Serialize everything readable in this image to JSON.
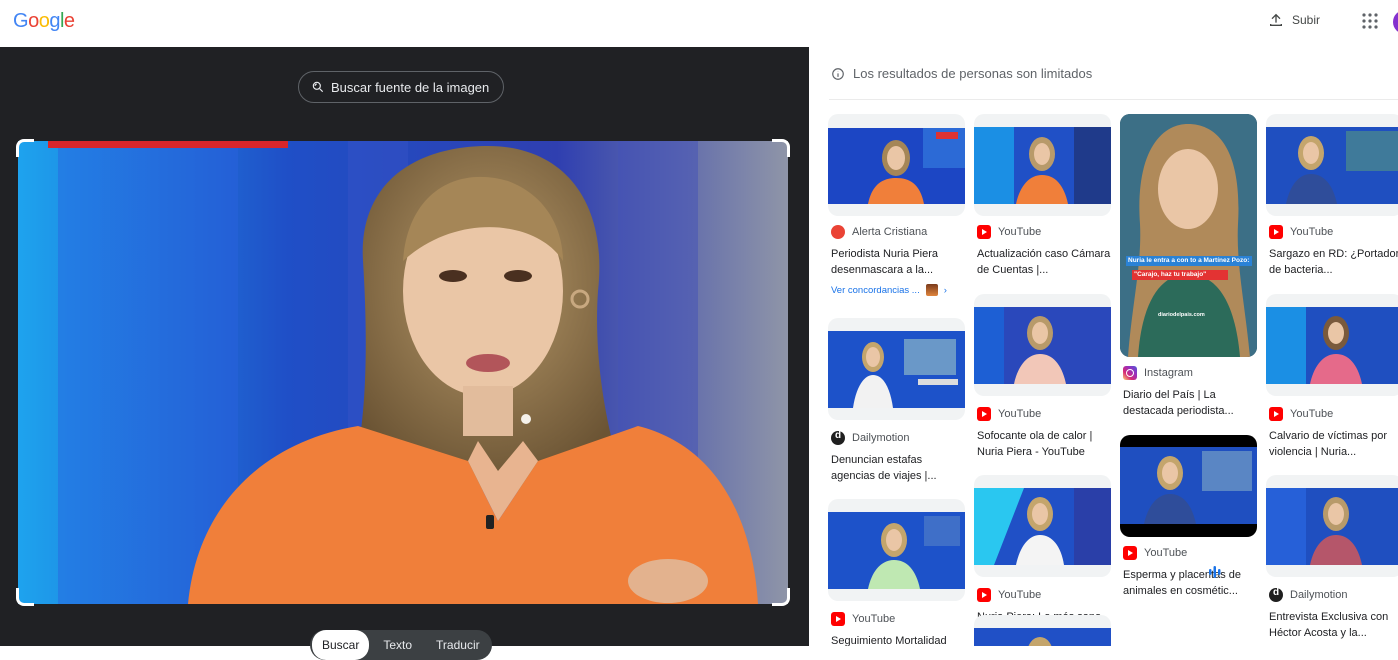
{
  "header": {
    "logo": "Google",
    "upload_label": "Subir",
    "apps_icon": "apps-grid-icon"
  },
  "colors": {
    "google_blue": "#4285F4",
    "google_red": "#EA4335",
    "google_yellow": "#FBBC05",
    "google_green": "#34A853",
    "dark_panel": "#202124",
    "link_blue": "#1a73e8"
  },
  "viewer": {
    "source_button": "Buscar fuente de la imagen",
    "modes": [
      "Buscar",
      "Texto",
      "Traducir"
    ],
    "active_mode": "Buscar"
  },
  "results": {
    "notice": "Los resultados de personas son limitados",
    "items": [
      {
        "source": "Alerta Cristiana",
        "title": "Periodista Nuria Piera desenmascara a la...",
        "more": "Ver concordancias ..."
      },
      {
        "source": "Dailymotion",
        "title": "Denuncian estafas agencias de viajes |..."
      },
      {
        "source": "YouTube",
        "title": "Seguimiento Mortalidad"
      },
      {
        "source": "YouTube",
        "title": "Actualización caso Cámara de Cuentas |..."
      },
      {
        "source": "YouTube",
        "title": "Sofocante ola de calor | Nuria Piera - YouTube"
      },
      {
        "source": "YouTube",
        "title": "Nuria Piera: Lo más sano para el país es la..."
      },
      {
        "source": "Instagram",
        "title": "Diario del País | La destacada periodista...",
        "overlay_line1": "Nuria le entra a con to a Martínez Pozo:",
        "overlay_line2": "\"Carajo, haz tu trabajo\"",
        "overlay_footer": "diariodelpais.com"
      },
      {
        "source": "YouTube",
        "title": "Esperma y placentas de animales en cosmétic..."
      },
      {
        "source": "YouTube",
        "title": "Sargazo en RD: ¿Portador de bacteria..."
      },
      {
        "source": "YouTube",
        "title": "Calvario de víctimas por violencia | Nuria..."
      },
      {
        "source": "Dailymotion",
        "title": "Entrevista Exclusiva con Héctor Acosta y la..."
      }
    ]
  }
}
